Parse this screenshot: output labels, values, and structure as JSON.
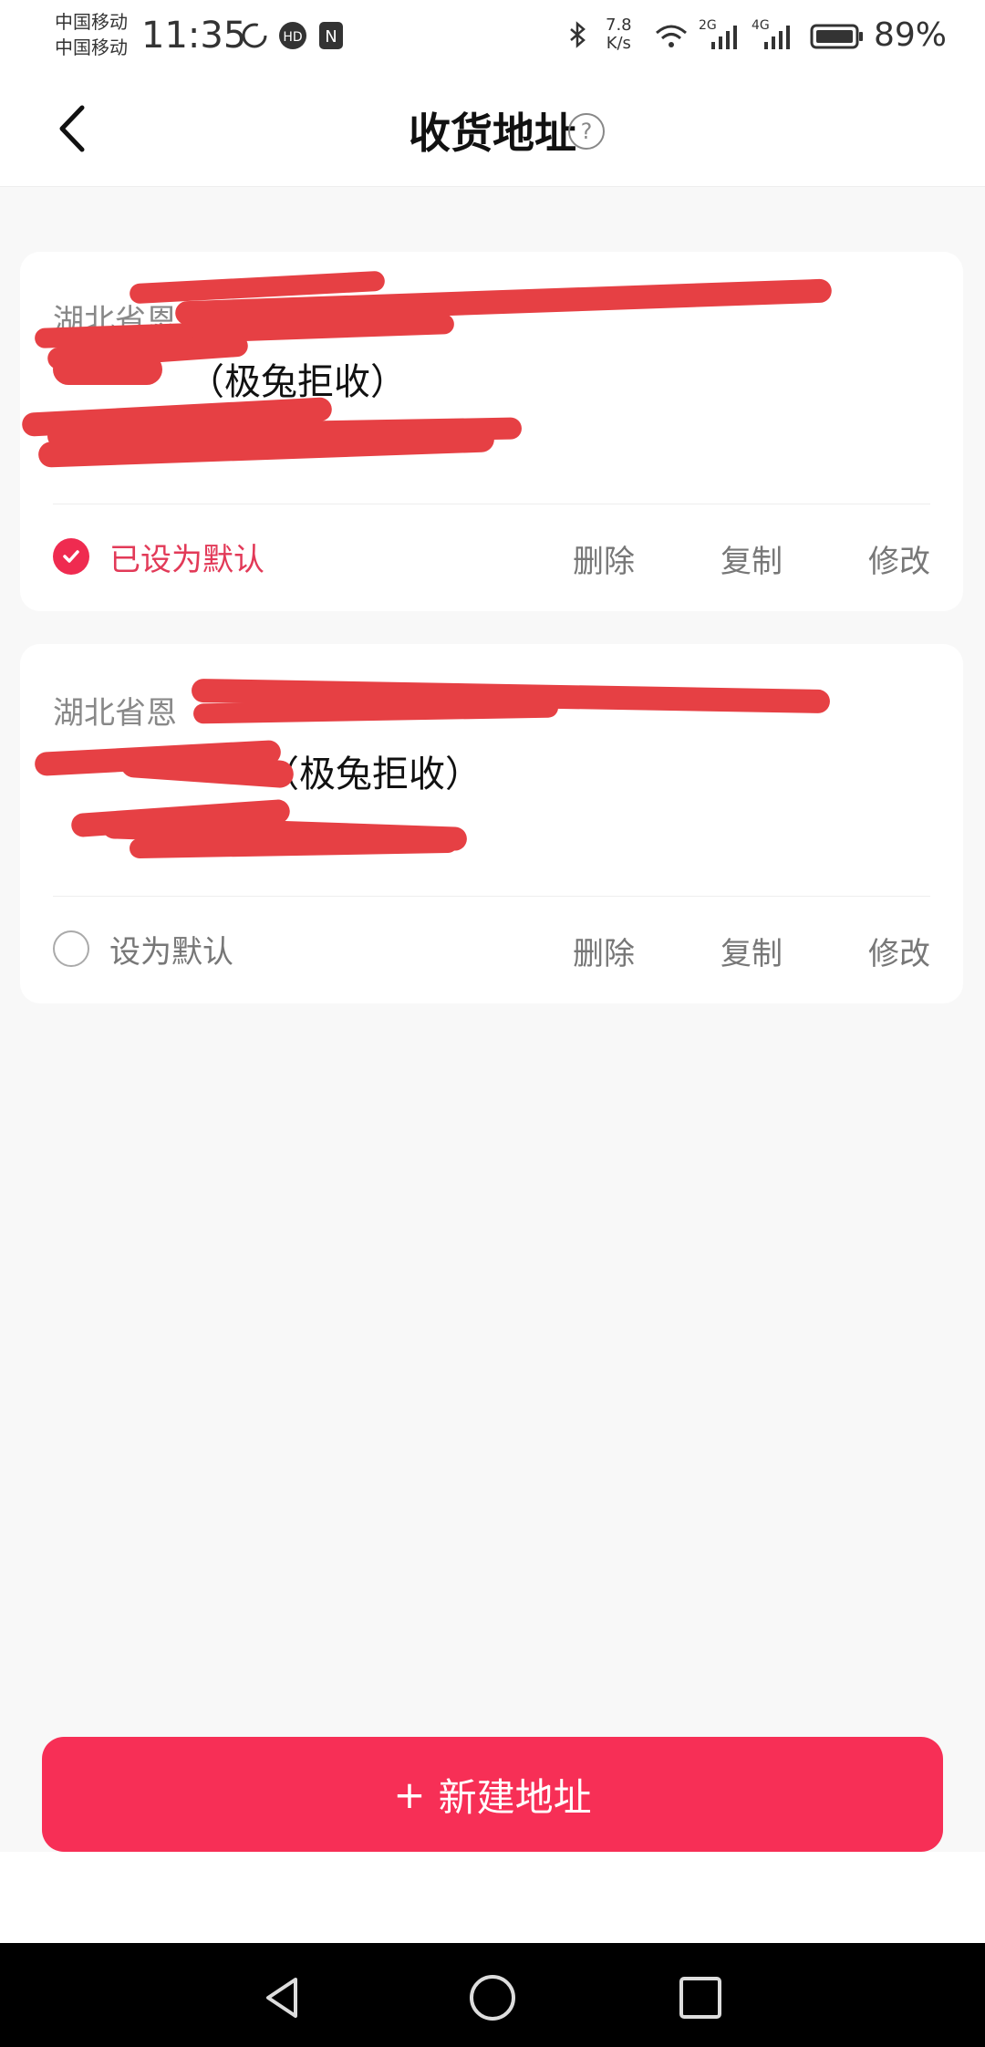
{
  "status_bar": {
    "carrier1": "中国移动",
    "carrier2": "中国移动",
    "time": "11:35",
    "speed": "7.8",
    "speed_unit": "K/s",
    "net1": "2G",
    "net2": "4G",
    "battery": "89%"
  },
  "header": {
    "title": "收货地址",
    "help": "?"
  },
  "addresses": [
    {
      "addr_prefix": "湖北省恩",
      "note": "（极兔拒收）",
      "is_default": true,
      "default_label": "已设为默认",
      "actions": {
        "delete": "删除",
        "copy": "复制",
        "edit": "修改"
      }
    },
    {
      "addr_prefix": "湖北省恩",
      "note": "（极兔拒收）",
      "is_default": false,
      "default_label": "设为默认",
      "actions": {
        "delete": "删除",
        "copy": "复制",
        "edit": "修改"
      }
    }
  ],
  "new_button": {
    "plus": "+",
    "label": "新建地址"
  },
  "colors": {
    "accent": "#f72f56",
    "redaction": "#e64044"
  }
}
